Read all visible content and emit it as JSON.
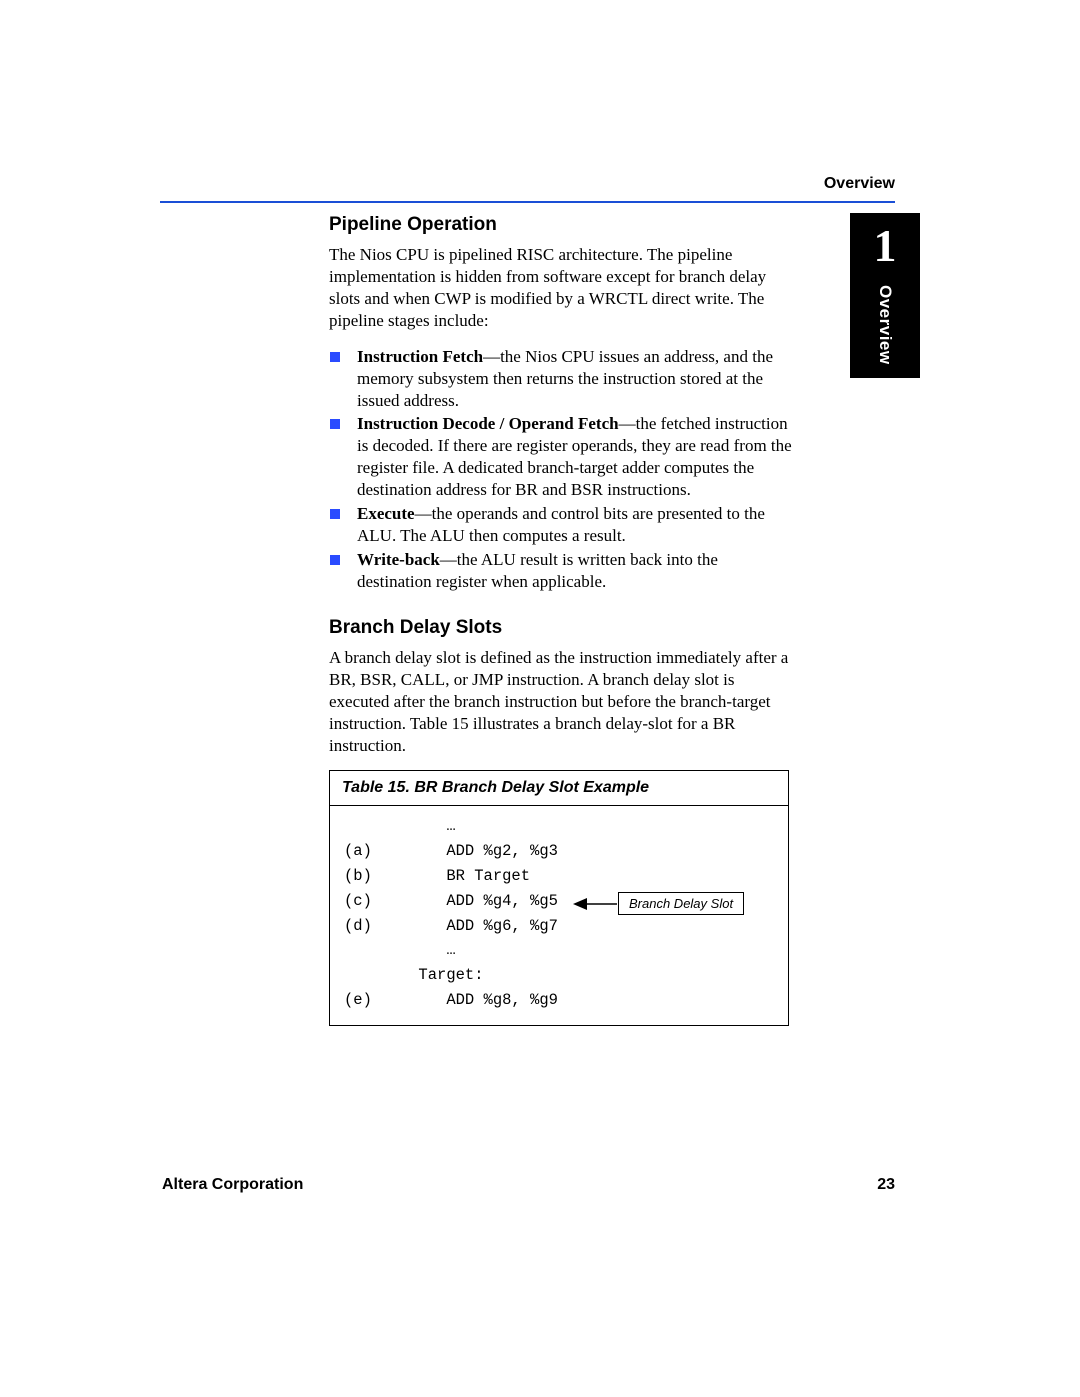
{
  "header": {
    "label": "Overview"
  },
  "chapter": {
    "num": "1",
    "label": "Overview"
  },
  "section1": {
    "title": "Pipeline Operation",
    "para": "The Nios CPU is pipelined RISC architecture. The pipeline implementation is hidden from software except for branch delay slots and when CWP is modified by a WRCTL direct write. The pipeline stages include:",
    "bullets": [
      {
        "bold": "Instruction Fetch",
        "rest": "—the Nios CPU issues an address, and the memory subsystem then returns the instruction stored at the issued address."
      },
      {
        "bold": "Instruction Decode / Operand Fetch",
        "rest": "—the fetched instruction is decoded. If there are register operands, they are read from the register file. A dedicated branch-target adder computes the destination address for BR and BSR instructions."
      },
      {
        "bold": "Execute",
        "rest": "—the operands and control bits are presented to the ALU. The ALU then computes a result."
      },
      {
        "bold": "Write-back",
        "rest": "—the ALU result is written back into the destination register when applicable."
      }
    ]
  },
  "section2": {
    "title": "Branch Delay Slots",
    "para": "A branch delay slot is defined as the instruction immediately after a BR, BSR, CALL, or JMP instruction. A branch delay slot is executed after the branch instruction but before the branch-target instruction. Table 15 illustrates a branch delay-slot for a BR instruction."
  },
  "table": {
    "title": "Table 15. BR Branch Delay Slot Example",
    "rows": [
      "           …",
      "(a)        ADD %g2, %g3",
      "(b)        BR Target",
      "(c)        ADD %g4, %g5",
      "(d)        ADD %g6, %g7",
      "           …",
      "        Target:",
      "(e)        ADD %g8, %g9"
    ],
    "annotation": "Branch Delay Slot"
  },
  "footer": {
    "left": "Altera Corporation",
    "right": "23"
  }
}
